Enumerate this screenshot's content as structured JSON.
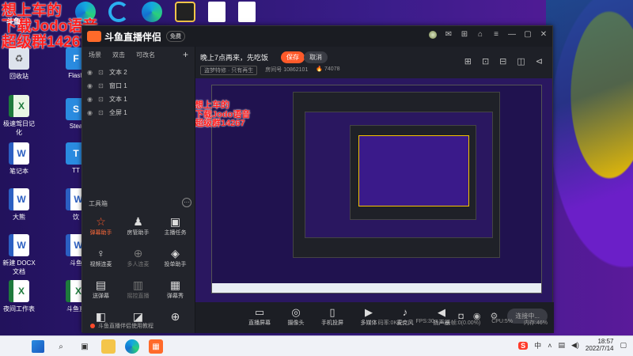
{
  "overlay": {
    "line1": "想上车的",
    "line2": "下载Jodo语音",
    "line3": "超级群14267",
    "handle": "斗鱼"
  },
  "desktop_icons": [
    {
      "label": "回收站",
      "glyph": "♻",
      "kind": "g-doc"
    },
    {
      "label": "Flash",
      "glyph": "F",
      "kind": "g-blue"
    },
    {
      "label": "极速驾日记化",
      "glyph": "X",
      "kind": "g-green"
    },
    {
      "label": "Stea",
      "glyph": "S",
      "kind": "g-blue"
    },
    {
      "label": "笔记本",
      "glyph": "W",
      "kind": "g-word"
    },
    {
      "label": "TT",
      "glyph": "T",
      "kind": "g-blue"
    },
    {
      "label": "大熊",
      "glyph": "W",
      "kind": "g-word"
    },
    {
      "label": "饮",
      "glyph": "W",
      "kind": "g-word"
    },
    {
      "label": "新建 DOCX 文档",
      "glyph": "W",
      "kind": "g-word"
    },
    {
      "label": "斗鱼",
      "glyph": "W",
      "kind": "g-word"
    },
    {
      "label": "夜间工作表",
      "glyph": "X",
      "kind": "g-excel"
    },
    {
      "label": "斗鱼直",
      "glyph": "X",
      "kind": "g-excel"
    }
  ],
  "app": {
    "brand": "斗鱼直播伴侣",
    "badge": "免费",
    "scene_tabs": [
      "场景",
      "双击",
      "可改名"
    ],
    "sources": [
      "文本 2",
      "窗口 1",
      "文本 1",
      "全屏 1"
    ],
    "tools_title": "工具箱",
    "tools": [
      {
        "label": "弹幕助手",
        "icon": "☆",
        "active": true,
        "dim": false
      },
      {
        "label": "房管助手",
        "icon": "♟",
        "active": false,
        "dim": false
      },
      {
        "label": "主播任务",
        "icon": "▣",
        "active": false,
        "dim": false
      },
      {
        "label": "视频连麦",
        "icon": "♀",
        "active": false,
        "dim": false
      },
      {
        "label": "多人连麦",
        "icon": "⊕",
        "active": false,
        "dim": true
      },
      {
        "label": "投单助手",
        "icon": "◈",
        "active": false,
        "dim": false
      },
      {
        "label": "送弹幕",
        "icon": "▤",
        "active": false,
        "dim": false
      },
      {
        "label": "摇控直播",
        "icon": "▥",
        "active": false,
        "dim": true
      },
      {
        "label": "弹幕秀",
        "icon": "▦",
        "active": false,
        "dim": false
      },
      {
        "label": "",
        "icon": "◧",
        "active": false,
        "dim": false
      },
      {
        "label": "",
        "icon": "◪",
        "active": false,
        "dim": false
      },
      {
        "label": "",
        "icon": "⊕",
        "active": false,
        "dim": false
      }
    ],
    "bottom_tip": "斗鱼直播伴侣使用教程",
    "stream_title": "晚上7点再来，先吃饭",
    "save": "保存",
    "cancel": "取消",
    "category": "盗梦特修 · 只有再生",
    "room_label": "房间号",
    "room_id": "10862101",
    "hot": "74078",
    "bottom_controls": [
      {
        "label": "直播屏幕",
        "icon": "▭"
      },
      {
        "label": "摄像头",
        "icon": "◎"
      },
      {
        "label": "手机投屏",
        "icon": "▯"
      },
      {
        "label": "多媒体",
        "icon": "▶"
      },
      {
        "label": "麦克风",
        "icon": "♪"
      },
      {
        "label": "扬声器",
        "icon": "◀"
      }
    ],
    "go_live": "连接中...",
    "status": {
      "rate": "码率:0Kb/s",
      "fps": "FPS:30",
      "drop": "丢帧:0(0.00%)",
      "cpu": "CPU:5%",
      "mem": "内存:46%"
    }
  },
  "taskbar": {
    "time": "18:57",
    "date": "2022/7/14",
    "ime": "中",
    "sogou": "S"
  }
}
